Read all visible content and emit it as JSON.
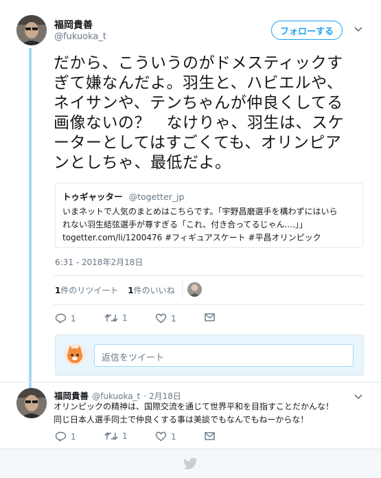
{
  "colors": {
    "accent": "#1da1f2",
    "thread_line": "#a4d8f5",
    "muted": "#657786"
  },
  "main_tweet": {
    "author_name": "福岡貴善",
    "author_handle": "@fukuoka_t",
    "follow_label": "フォローする",
    "text_lines": [
      "だから、こういうのがドメスティックす",
      "ぎて嫌なんだよ。羽生と、ハビエルや、",
      "ネイサンや、テンちゃんが仲良くしてる",
      "画像ないの？　なけりゃ、羽生は、スケ",
      "ーターとしてはすごくても、オリンピア",
      "ンとしちゃ、最低だよ。"
    ],
    "quote": {
      "name": "トゥギャッター",
      "handle": "@togetter_jp",
      "lines": [
        "いまネットで人気のまとめはこちらです。「宇野昌磨選手を構わずにはいら",
        "れない羽生結弦選手が尊すぎる「これ、付き合ってるじゃん....」」",
        "togetter.com/li/1200476 #フィギュアスケート #平昌オリンピック"
      ]
    },
    "timestamp": "6:31 - 2018年2月18日",
    "stats": {
      "retweet_count": "1",
      "retweet_label": "件のリツイート",
      "like_count": "1",
      "like_label": "件のいいね"
    },
    "actions": {
      "reply_count": "1",
      "retweet_count": "1",
      "like_count": "1"
    },
    "reply_placeholder": "返信をツイート"
  },
  "reply_tweet": {
    "author_name": "福岡貴善",
    "author_handle": "@fukuoka_t",
    "date": "· 2月18日",
    "lines": [
      "オリンピックの精神は、国際交流を通じて世界平和を目指すことだかんな！",
      "同じ日本人選手同士で仲良くする事は美談でもなんでもねーからな！"
    ],
    "actions": {
      "reply_count": "1",
      "retweet_count": "1",
      "like_count": "1"
    }
  },
  "icons": [
    "chevron-down-icon",
    "reply-icon",
    "retweet-icon",
    "like-icon",
    "message-icon",
    "bird-icon"
  ]
}
